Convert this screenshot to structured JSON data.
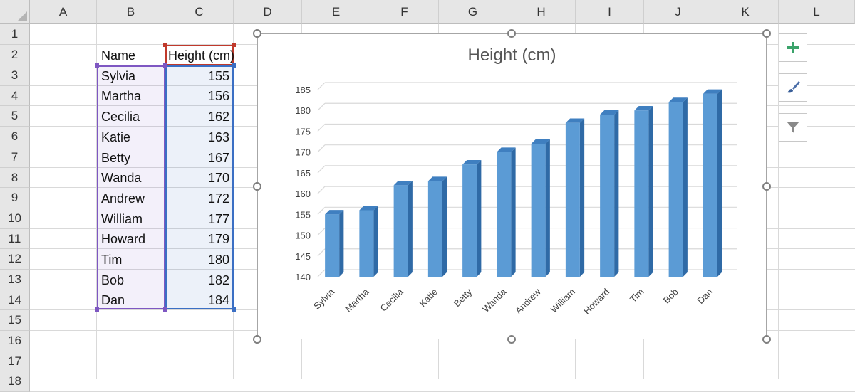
{
  "columns": [
    "A",
    "B",
    "C",
    "D",
    "E",
    "F",
    "G",
    "H",
    "I",
    "J",
    "K",
    "L"
  ],
  "rows": [
    "1",
    "2",
    "3",
    "4",
    "5",
    "6",
    "7",
    "8",
    "9",
    "10",
    "11",
    "12",
    "13",
    "14",
    "15",
    "16",
    "17",
    "18"
  ],
  "table": {
    "header": {
      "name": "Name",
      "height": "Height (cm)"
    },
    "rows": [
      {
        "name": "Sylvia",
        "height": "155"
      },
      {
        "name": "Martha",
        "height": "156"
      },
      {
        "name": "Cecilia",
        "height": "162"
      },
      {
        "name": "Katie",
        "height": "163"
      },
      {
        "name": "Betty",
        "height": "167"
      },
      {
        "name": "Wanda",
        "height": "170"
      },
      {
        "name": "Andrew",
        "height": "172"
      },
      {
        "name": "William",
        "height": "177"
      },
      {
        "name": "Howard",
        "height": "179"
      },
      {
        "name": "Tim",
        "height": "180"
      },
      {
        "name": "Bob",
        "height": "182"
      },
      {
        "name": "Dan",
        "height": "184"
      }
    ]
  },
  "colors": {
    "bar": "#5b9bd5",
    "bar_side": "#2f6aa6",
    "bar_top": "#3f7fc0",
    "grid": "#d9d9d9",
    "plus_icon": "#3aa36a",
    "name_range": "#7e57c2",
    "value_range": "#3b6fc4",
    "header_range": "#c0392b"
  },
  "chart_data": {
    "type": "bar",
    "style": "3-D clustered column",
    "title": "Height (cm)",
    "categories": [
      "Sylvia",
      "Martha",
      "Cecilia",
      "Katie",
      "Betty",
      "Wanda",
      "Andrew",
      "William",
      "Howard",
      "Tim",
      "Bob",
      "Dan"
    ],
    "values": [
      155,
      156,
      162,
      163,
      167,
      170,
      172,
      177,
      179,
      180,
      182,
      184
    ],
    "ylim": [
      140,
      185
    ],
    "yticks": [
      "140",
      "145",
      "150",
      "155",
      "160",
      "165",
      "170",
      "175",
      "180",
      "185"
    ],
    "grid": true,
    "legend": "none"
  },
  "chart_tools": {
    "elements_icon": "plus-icon",
    "styles_icon": "paintbrush-icon",
    "filters_icon": "filter-icon"
  }
}
